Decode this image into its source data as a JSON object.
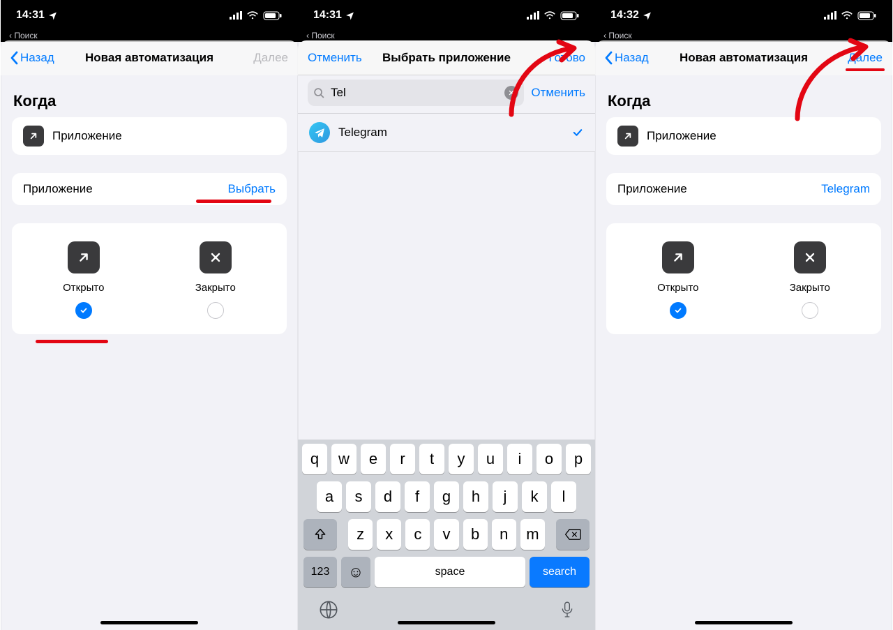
{
  "status": {
    "time_a": "14:31",
    "time_b": "14:31",
    "time_c": "14:32",
    "breadcrumb": "Поиск"
  },
  "nav": {
    "back": "Назад",
    "title_auto": "Новая автоматизация",
    "next": "Далее",
    "cancel": "Отменить",
    "title_choose": "Выбрать приложение",
    "done": "Готово"
  },
  "sections": {
    "when": "Когда"
  },
  "rows": {
    "app": "Приложение",
    "app_label": "Приложение",
    "choose": "Выбрать",
    "telegram": "Telegram"
  },
  "opts": {
    "open": "Открыто",
    "closed": "Закрыто"
  },
  "search": {
    "value": "Tel",
    "cancel": "Отменить"
  },
  "result": {
    "telegram": "Telegram"
  },
  "keyboard": {
    "r1": [
      "q",
      "w",
      "e",
      "r",
      "t",
      "y",
      "u",
      "i",
      "o",
      "p"
    ],
    "r2": [
      "a",
      "s",
      "d",
      "f",
      "g",
      "h",
      "j",
      "k",
      "l"
    ],
    "r3": [
      "z",
      "x",
      "c",
      "v",
      "b",
      "n",
      "m"
    ],
    "num": "123",
    "space": "space",
    "search": "search"
  }
}
